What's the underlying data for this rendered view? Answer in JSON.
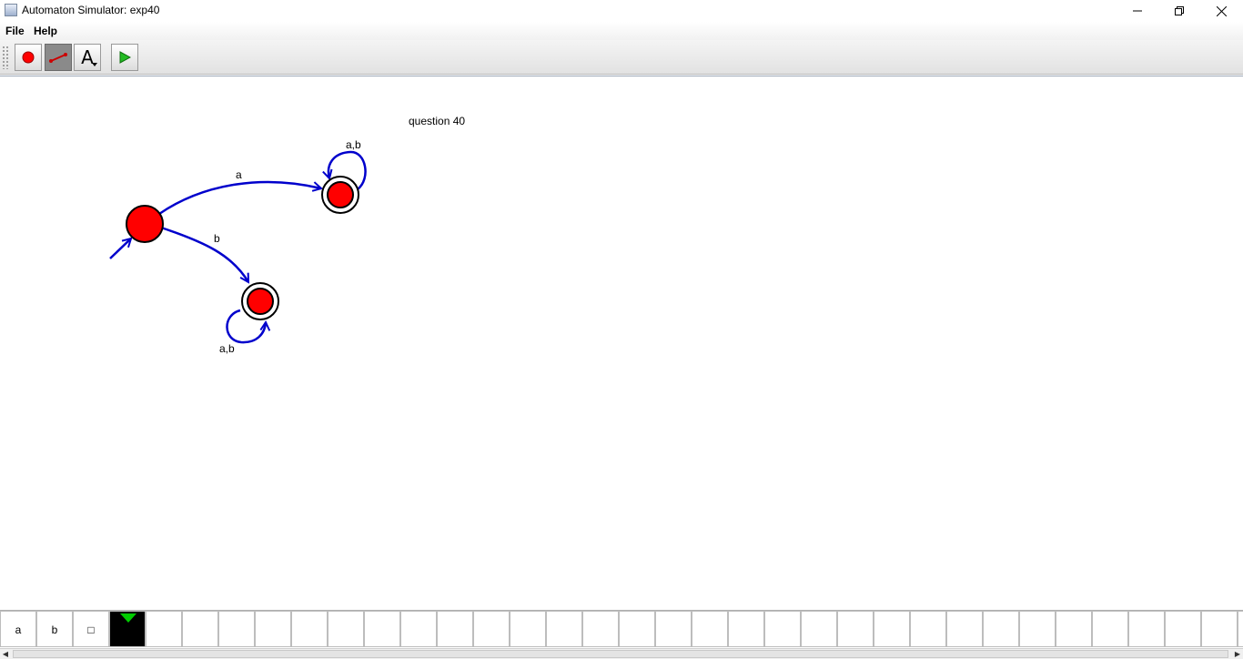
{
  "window": {
    "title": "Automaton Simulator: exp40"
  },
  "menu": {
    "items": [
      "File",
      "Help"
    ]
  },
  "toolbar": {
    "tools": [
      {
        "name": "state-tool",
        "icon": "red-circle-icon"
      },
      {
        "name": "transition-tool",
        "icon": "arrow-line-icon",
        "active": true
      },
      {
        "name": "text-tool",
        "icon": "letter-a-icon",
        "label": "A"
      },
      {
        "name": "run-button",
        "icon": "play-icon"
      }
    ]
  },
  "canvas": {
    "label": "question 40",
    "states": [
      {
        "id": "q0",
        "initial": true,
        "final": false
      },
      {
        "id": "q1",
        "initial": false,
        "final": true
      },
      {
        "id": "q2",
        "initial": false,
        "final": true
      }
    ],
    "transitions": [
      {
        "from": "q0",
        "to": "q1",
        "label": "a"
      },
      {
        "from": "q0",
        "to": "q2",
        "label": "b"
      },
      {
        "from": "q1",
        "to": "q1",
        "label": "a,b"
      },
      {
        "from": "q2",
        "to": "q2",
        "label": "a,b"
      }
    ]
  },
  "tape": {
    "cells": [
      "a",
      "b",
      "□",
      "",
      "",
      "",
      "",
      "",
      "",
      "",
      "",
      "",
      "",
      "",
      "",
      "",
      "",
      "",
      "",
      "",
      "",
      "",
      "",
      "",
      "",
      "",
      "",
      "",
      "",
      "",
      "",
      "",
      "",
      "",
      ""
    ],
    "head_index": 3
  },
  "colors": {
    "state_fill": "#ff0000",
    "arrow": "#0000cc",
    "head": "#000000",
    "head_marker": "#00cc00"
  }
}
